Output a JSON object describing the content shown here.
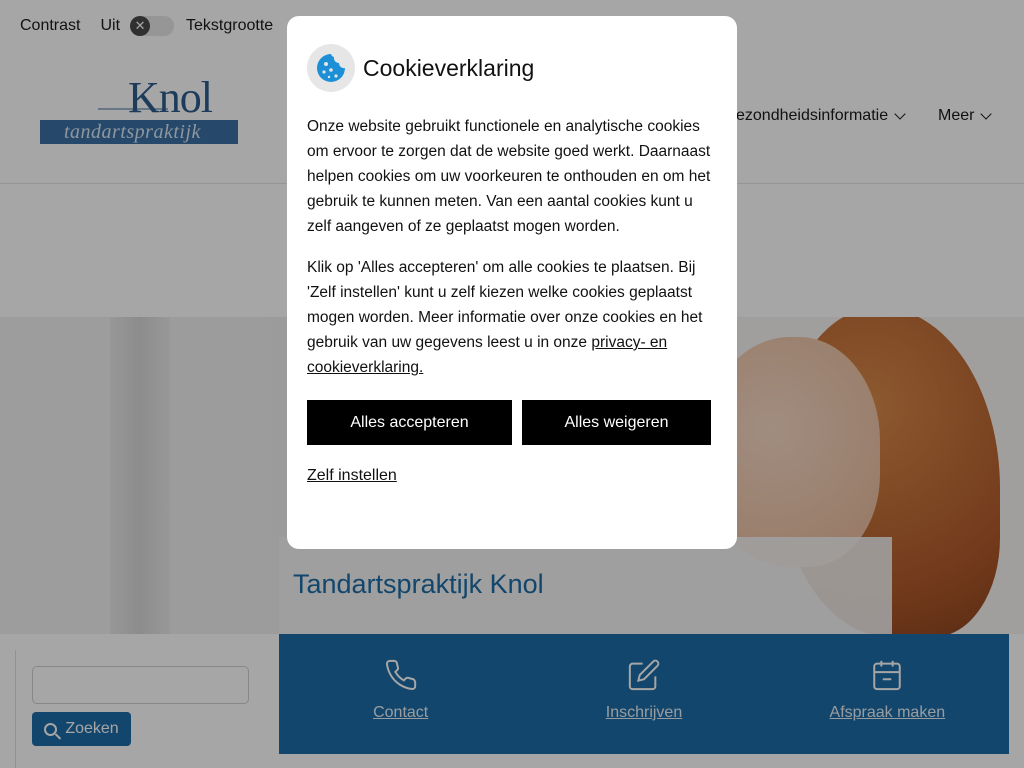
{
  "topbar": {
    "contrast_label": "Contrast",
    "contrast_state": "Uit",
    "text_size_label": "Tekstgrootte"
  },
  "logo": {
    "name": "Knol",
    "subtitle": "tandartspraktijk"
  },
  "nav": {
    "items": [
      {
        "label": "Gezondheidsinformatie",
        "visible_label": "ezondheidsinformatie",
        "has_dropdown": true
      },
      {
        "label": "Meer",
        "has_dropdown": true
      }
    ]
  },
  "hero": {
    "title": "Tandartspraktijk Knol"
  },
  "search": {
    "placeholder": "",
    "button_label": "Zoeken"
  },
  "actions": [
    {
      "label": "Contact",
      "icon": "phone-icon"
    },
    {
      "label": "Inschrijven",
      "icon": "edit-icon"
    },
    {
      "label": "Afspraak maken",
      "icon": "calendar-icon"
    }
  ],
  "cookie_modal": {
    "title": "Cookieverklaring",
    "icon": "cookie-icon",
    "paragraph1": "Onze website gebruikt functionele en analytische cookies om ervoor te zorgen dat de website goed werkt. Daarnaast helpen cookies om uw voorkeuren te onthouden en om het gebruik te kunnen meten. Van een aantal cookies kunt u zelf aangeven of ze geplaatst mogen worden.",
    "paragraph2_text": "Klik op 'Alles accepteren' om alle cookies te plaatsen. Bij 'Zelf instellen' kunt u zelf kiezen welke cookies geplaatst mogen worden. Meer informatie over onze cookies en het gebruik van uw gegevens leest u in onze ",
    "privacy_link": "privacy- en cookieverklaring.",
    "accept_label": "Alles accepteren",
    "reject_label": "Alles weigeren",
    "self_set_label": "Zelf instellen"
  },
  "colors": {
    "brand_blue": "#1c6ca6",
    "button_black": "#000000",
    "overlay": "rgba(0,0,0,0.35)"
  }
}
